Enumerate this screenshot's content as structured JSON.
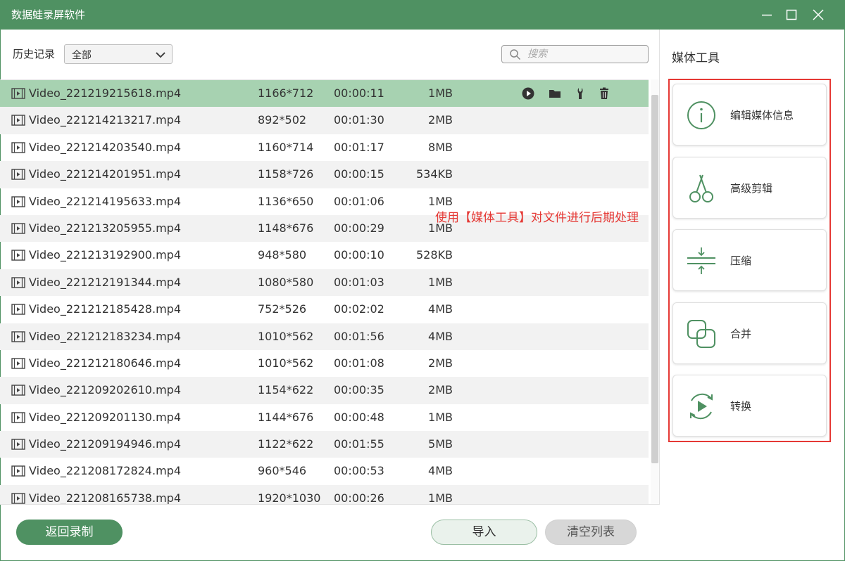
{
  "window": {
    "title": "数据蛙录屏软件"
  },
  "toolbar": {
    "history_label": "历史记录",
    "filter_value": "全部",
    "search_placeholder": "搜索"
  },
  "files": [
    {
      "name": "Video_221219215618.mp4",
      "resolution": "1166*712",
      "duration": "00:00:11",
      "size": "1MB"
    },
    {
      "name": "Video_221214213217.mp4",
      "resolution": "892*502",
      "duration": "00:01:30",
      "size": "2MB"
    },
    {
      "name": "Video_221214203540.mp4",
      "resolution": "1160*714",
      "duration": "00:01:17",
      "size": "8MB"
    },
    {
      "name": "Video_221214201951.mp4",
      "resolution": "1158*726",
      "duration": "00:00:15",
      "size": "534KB"
    },
    {
      "name": "Video_221214195633.mp4",
      "resolution": "1136*650",
      "duration": "00:01:06",
      "size": "1MB"
    },
    {
      "name": "Video_221213205955.mp4",
      "resolution": "1148*676",
      "duration": "00:00:29",
      "size": "1MB"
    },
    {
      "name": "Video_221213192900.mp4",
      "resolution": "948*580",
      "duration": "00:00:10",
      "size": "528KB"
    },
    {
      "name": "Video_221212191344.mp4",
      "resolution": "1080*580",
      "duration": "00:01:03",
      "size": "1MB"
    },
    {
      "name": "Video_221212185428.mp4",
      "resolution": "752*526",
      "duration": "00:02:02",
      "size": "4MB"
    },
    {
      "name": "Video_221212183234.mp4",
      "resolution": "1010*562",
      "duration": "00:01:56",
      "size": "4MB"
    },
    {
      "name": "Video_221212180646.mp4",
      "resolution": "1010*562",
      "duration": "00:01:08",
      "size": "2MB"
    },
    {
      "name": "Video_221209202610.mp4",
      "resolution": "1154*622",
      "duration": "00:00:35",
      "size": "2MB"
    },
    {
      "name": "Video_221209201130.mp4",
      "resolution": "1144*676",
      "duration": "00:00:48",
      "size": "1MB"
    },
    {
      "name": "Video_221209194946.mp4",
      "resolution": "1122*622",
      "duration": "00:01:55",
      "size": "5MB"
    },
    {
      "name": "Video_221208172824.mp4",
      "resolution": "960*546",
      "duration": "00:00:53",
      "size": "4MB"
    },
    {
      "name": "Video_221208165738.mp4",
      "resolution": "1920*1030",
      "duration": "00:00:26",
      "size": "1MB"
    }
  ],
  "row_actions": [
    "play-icon",
    "folder-icon",
    "wrench-icon",
    "trash-icon"
  ],
  "side_panel": {
    "title": "媒体工具",
    "tools": [
      {
        "label": "编辑媒体信息",
        "icon": "info-icon"
      },
      {
        "label": "高级剪辑",
        "icon": "scissors-icon"
      },
      {
        "label": "压缩",
        "icon": "compress-icon"
      },
      {
        "label": "合并",
        "icon": "merge-icon"
      },
      {
        "label": "转换",
        "icon": "convert-icon"
      }
    ]
  },
  "annotation": "使用【媒体工具】对文件进行后期处理",
  "footer": {
    "back_label": "返回录制",
    "import_label": "导入",
    "clear_label": "清空列表"
  },
  "colors": {
    "brand": "#4f9162",
    "selected_row": "#a7d2b1",
    "highlight_box": "#e53935"
  }
}
